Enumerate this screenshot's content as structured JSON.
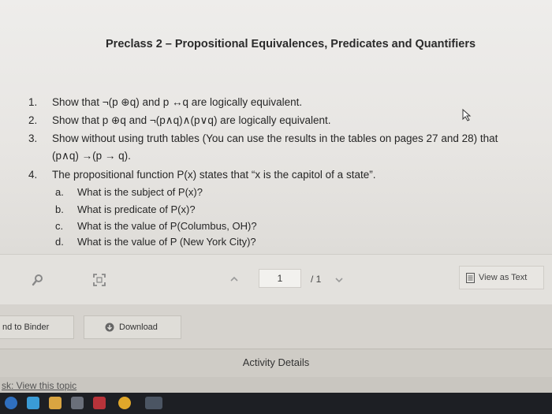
{
  "document": {
    "title": "Preclass 2 – Propositional Equivalences, Predicates and Quantifiers",
    "questions": [
      {
        "num": "1.",
        "text": "Show that ¬(p ⊕q) and p ↔q are logically equivalent."
      },
      {
        "num": "2.",
        "text": "Show that p ⊕q and ¬(p∧q)∧(p∨q) are logically equivalent."
      },
      {
        "num": "3.",
        "text": "Show without using truth tables (You can use the results in the tables on pages 27 and 28) that",
        "text2": "(p∧q) →(p → q)."
      },
      {
        "num": "4.",
        "text": "The propositional function P(x) states that “x is the capitol of a state”."
      }
    ],
    "subparts": [
      {
        "letter": "a.",
        "text": "What is the subject of P(x)?"
      },
      {
        "letter": "b.",
        "text": "What is predicate of P(x)?"
      },
      {
        "letter": "c.",
        "text": "What is the value of P(Columbus, OH)?"
      },
      {
        "letter": "d.",
        "text": "What is the value of P (New York City)?"
      }
    ]
  },
  "toolbar": {
    "search_icon": "search-icon",
    "fullscreen_icon": "fullscreen-icon",
    "page_current": "1",
    "page_total": "/ 1",
    "view_as_text": "View as Text"
  },
  "actions": {
    "add_to_binder": "nd to Binder",
    "download": "Download"
  },
  "activity": {
    "label": "Activity Details"
  },
  "footer": {
    "view_topic": "sk: View this topic"
  },
  "colors": {
    "document_bg": "#eeedeb",
    "toolbar_bg": "#e3e1dd",
    "taskbar_bg": "#1d1f24"
  }
}
